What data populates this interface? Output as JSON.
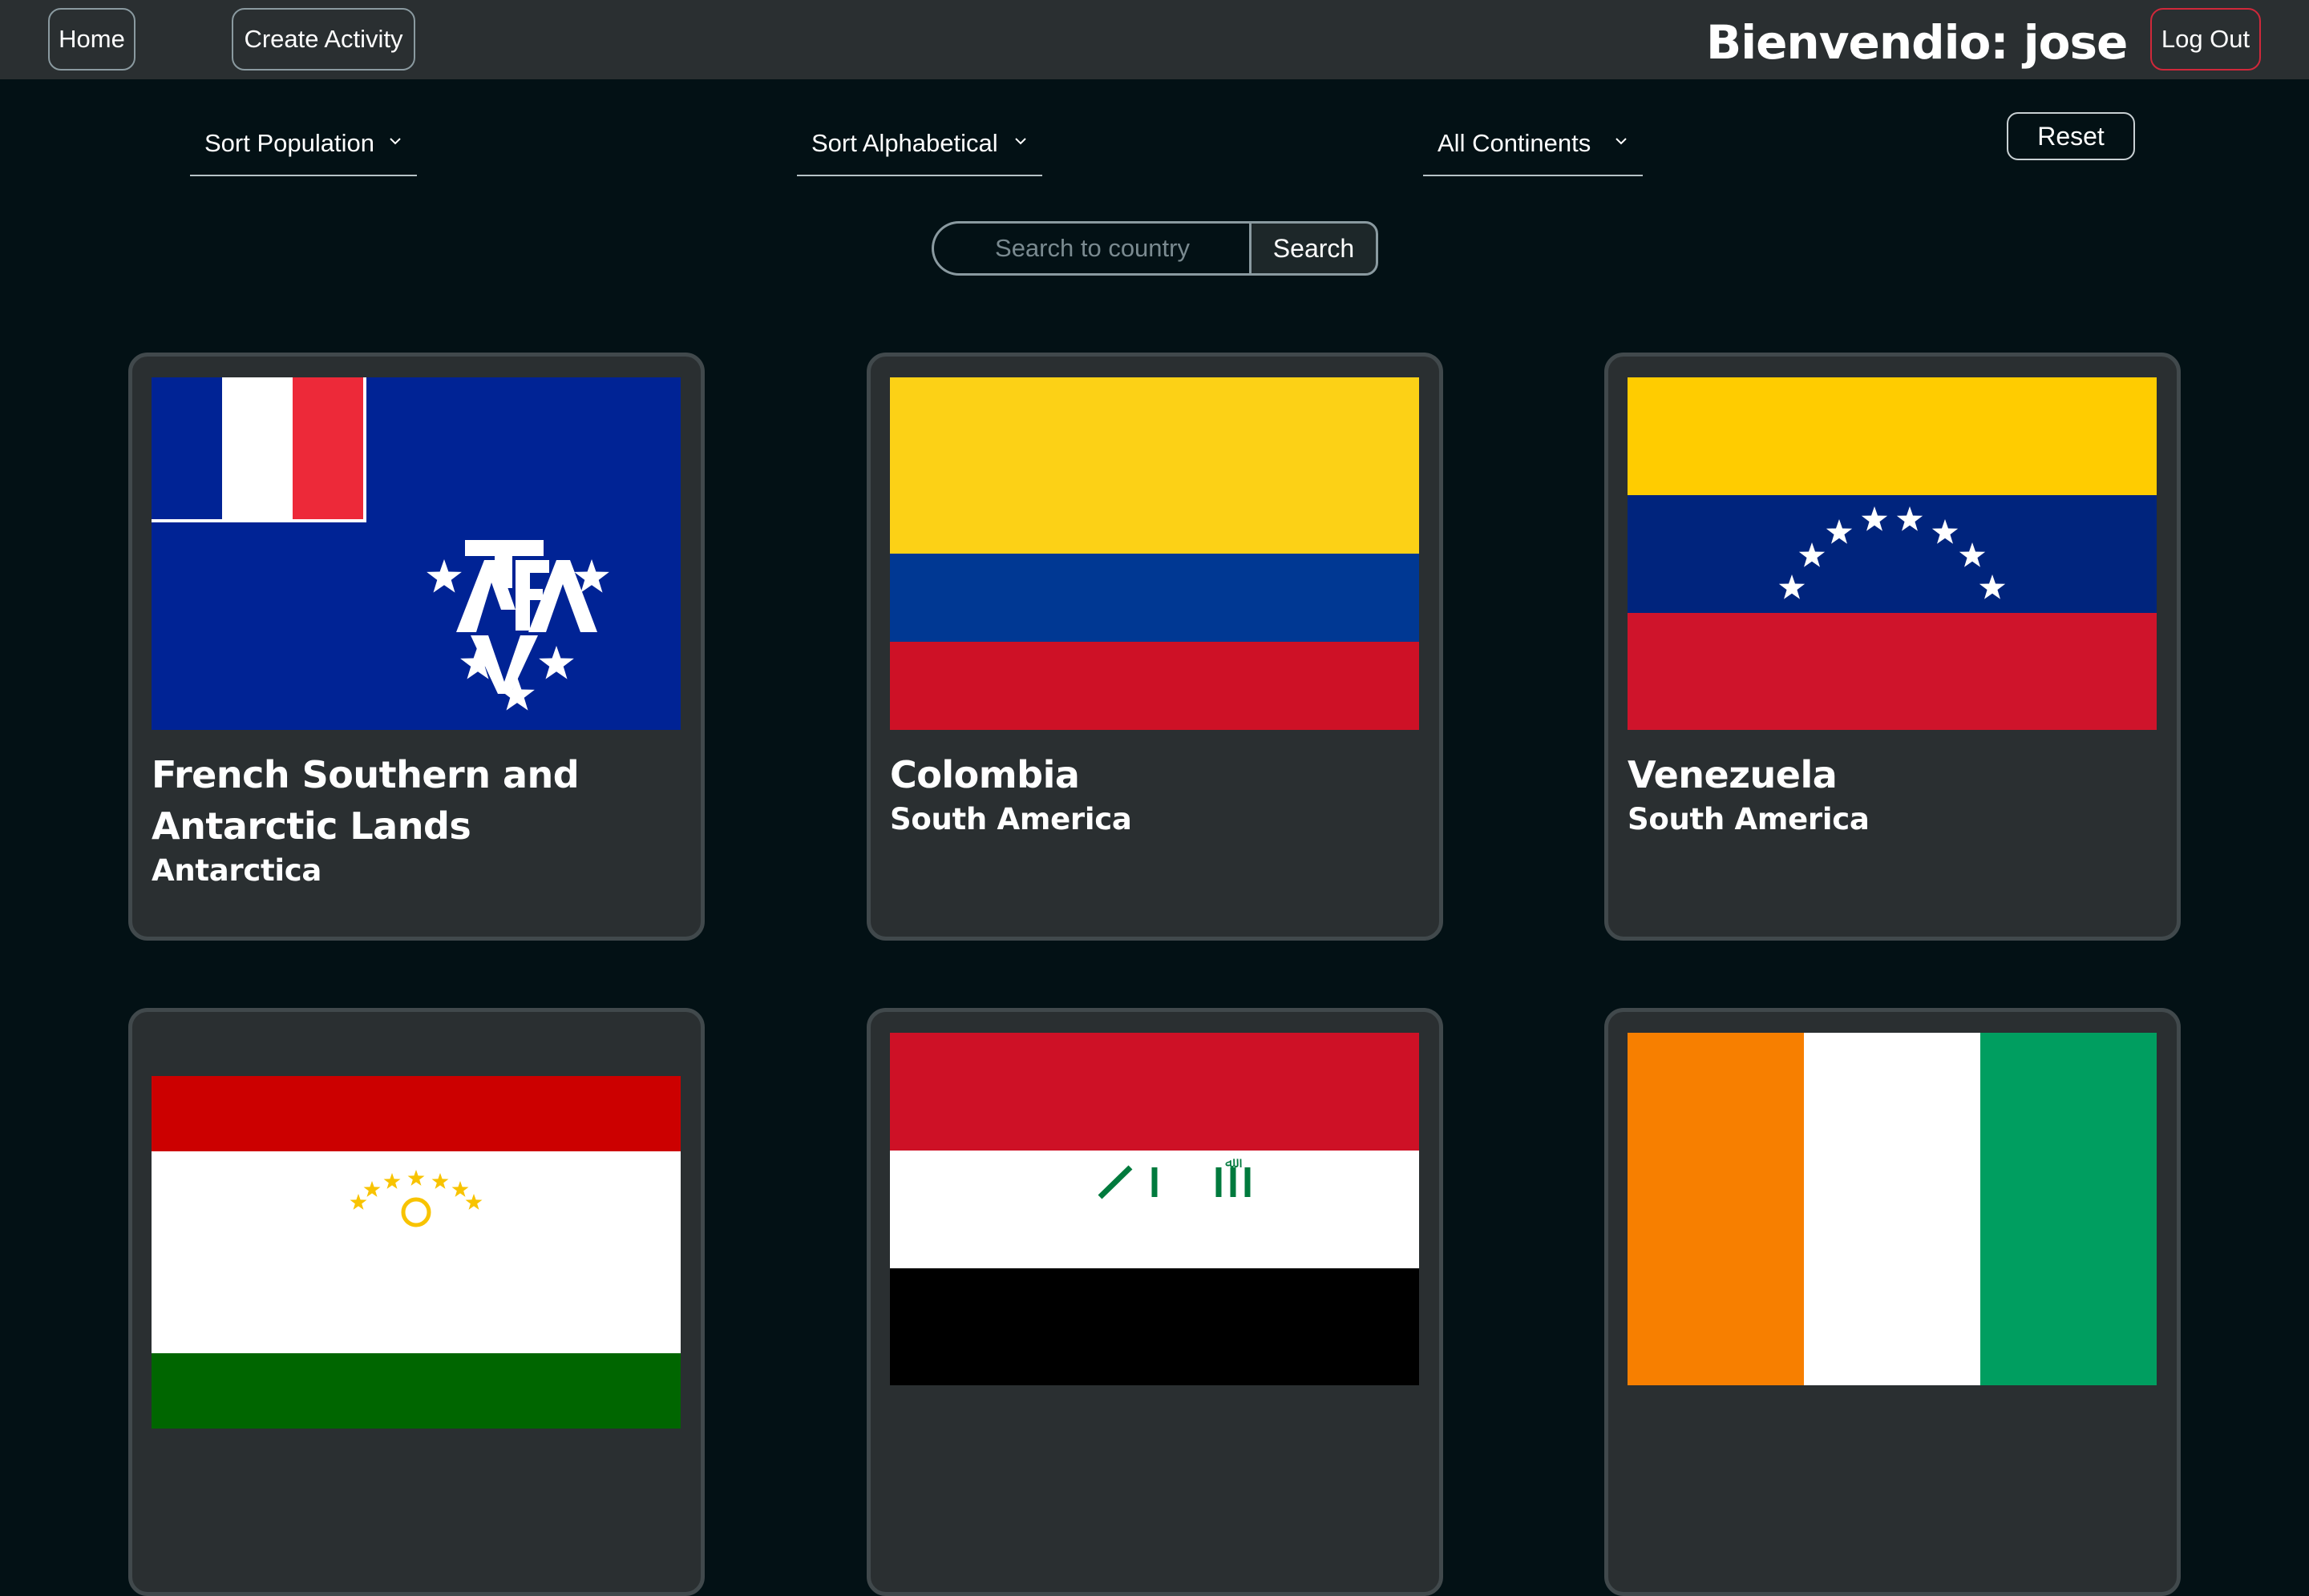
{
  "navbar": {
    "home_label": "Home",
    "create_label": "Create Activity",
    "welcome": "Bienvendio: jose",
    "logout_label": "Log Out"
  },
  "filters": {
    "sort_population": "Sort Population",
    "sort_alphabetical": "Sort Alphabetical",
    "continents": "All Continents",
    "reset_label": "Reset"
  },
  "search": {
    "placeholder": "Search to country",
    "button_label": "Search"
  },
  "countries": [
    {
      "name": "French Southern and Antarctic Lands",
      "continent": "Antarctica",
      "flag": "french-southern-antarctic-lands-flag"
    },
    {
      "name": "Colombia",
      "continent": "South America",
      "flag": "colombia-flag"
    },
    {
      "name": "Venezuela",
      "continent": "South America",
      "flag": "venezuela-flag"
    },
    {
      "name": "",
      "continent": "",
      "flag": "tajikistan-flag"
    },
    {
      "name": "",
      "continent": "",
      "flag": "iraq-flag"
    },
    {
      "name": "",
      "continent": "",
      "flag": "ivory-coast-flag"
    }
  ],
  "colors": {
    "background": "#031115",
    "navbar": "#2a2f31",
    "card": "#2a2f31",
    "logout_border": "#d0283a"
  }
}
